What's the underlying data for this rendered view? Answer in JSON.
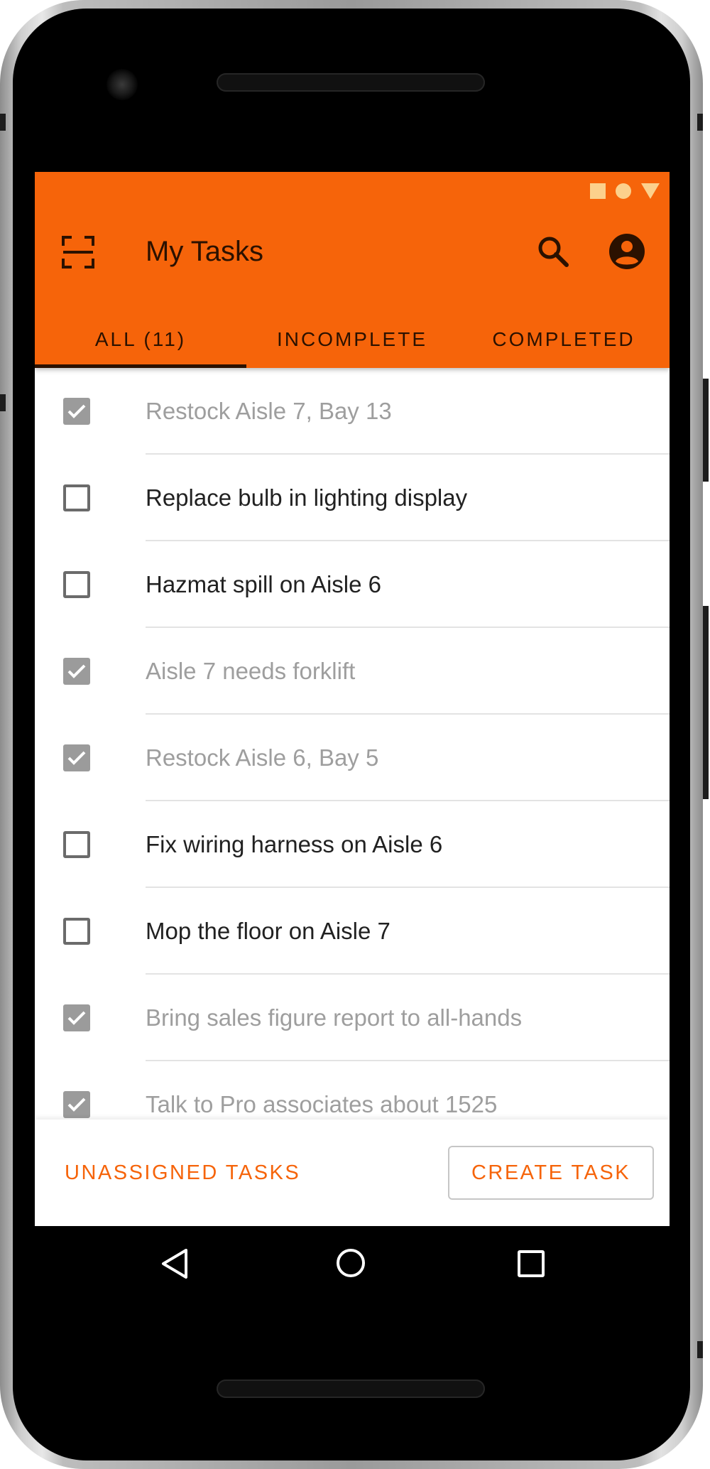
{
  "app": {
    "title": "My Tasks",
    "accent_color": "#f6640a",
    "header_text_color": "#2b1100"
  },
  "status_bar": {
    "icons": [
      "square-icon",
      "circle-icon",
      "triangle-icon"
    ]
  },
  "header_icons": {
    "scan": "scan-icon",
    "search": "search-icon",
    "account": "account-circle-icon"
  },
  "tabs": [
    {
      "label": "ALL (11)",
      "active": true
    },
    {
      "label": "INCOMPLETE",
      "active": false
    },
    {
      "label": "COMPLETED",
      "active": false
    }
  ],
  "tasks": [
    {
      "label": "Restock Aisle 7, Bay 13",
      "completed": true
    },
    {
      "label": "Replace bulb in lighting display",
      "completed": false
    },
    {
      "label": "Hazmat spill on Aisle 6",
      "completed": false
    },
    {
      "label": "Aisle 7 needs forklift",
      "completed": true
    },
    {
      "label": "Restock Aisle 6, Bay 5",
      "completed": true
    },
    {
      "label": "Fix wiring harness on Aisle 6",
      "completed": false
    },
    {
      "label": "Mop the floor on Aisle 7",
      "completed": false
    },
    {
      "label": "Bring sales figure report to all-hands",
      "completed": true
    },
    {
      "label": "Talk to Pro associates about 1525",
      "completed": true
    }
  ],
  "footer": {
    "unassigned_label": "UNASSIGNED TASKS",
    "create_label": "CREATE TASK"
  },
  "navigation": {
    "icons": [
      "back-icon",
      "home-icon",
      "recents-icon"
    ]
  }
}
